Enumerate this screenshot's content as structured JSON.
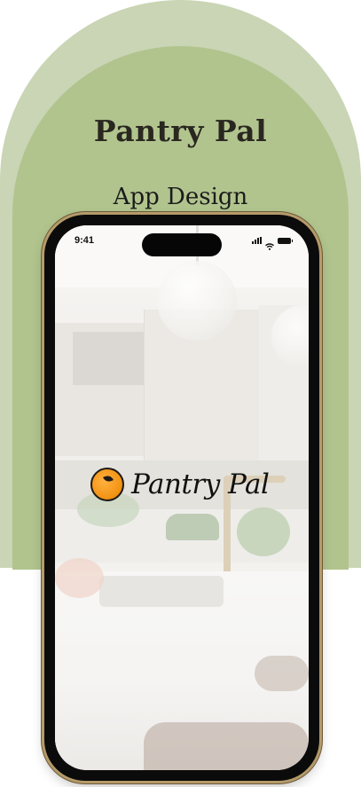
{
  "header": {
    "title": "Pantry Pal",
    "subtitle": "App Design"
  },
  "phone": {
    "status_bar": {
      "time": "9:41",
      "icons": [
        "signal-icon",
        "wifi-icon",
        "battery-icon"
      ]
    },
    "splash": {
      "logo_icon": "orange-icon",
      "logo_text": "Pantry Pal"
    }
  },
  "colors": {
    "arch_outer": "#c9d5b4",
    "arch_inner": "#b1c48e",
    "title_text": "#2a2720",
    "phone_frame": "#b59b6a",
    "logo_orange": "#f29414"
  }
}
